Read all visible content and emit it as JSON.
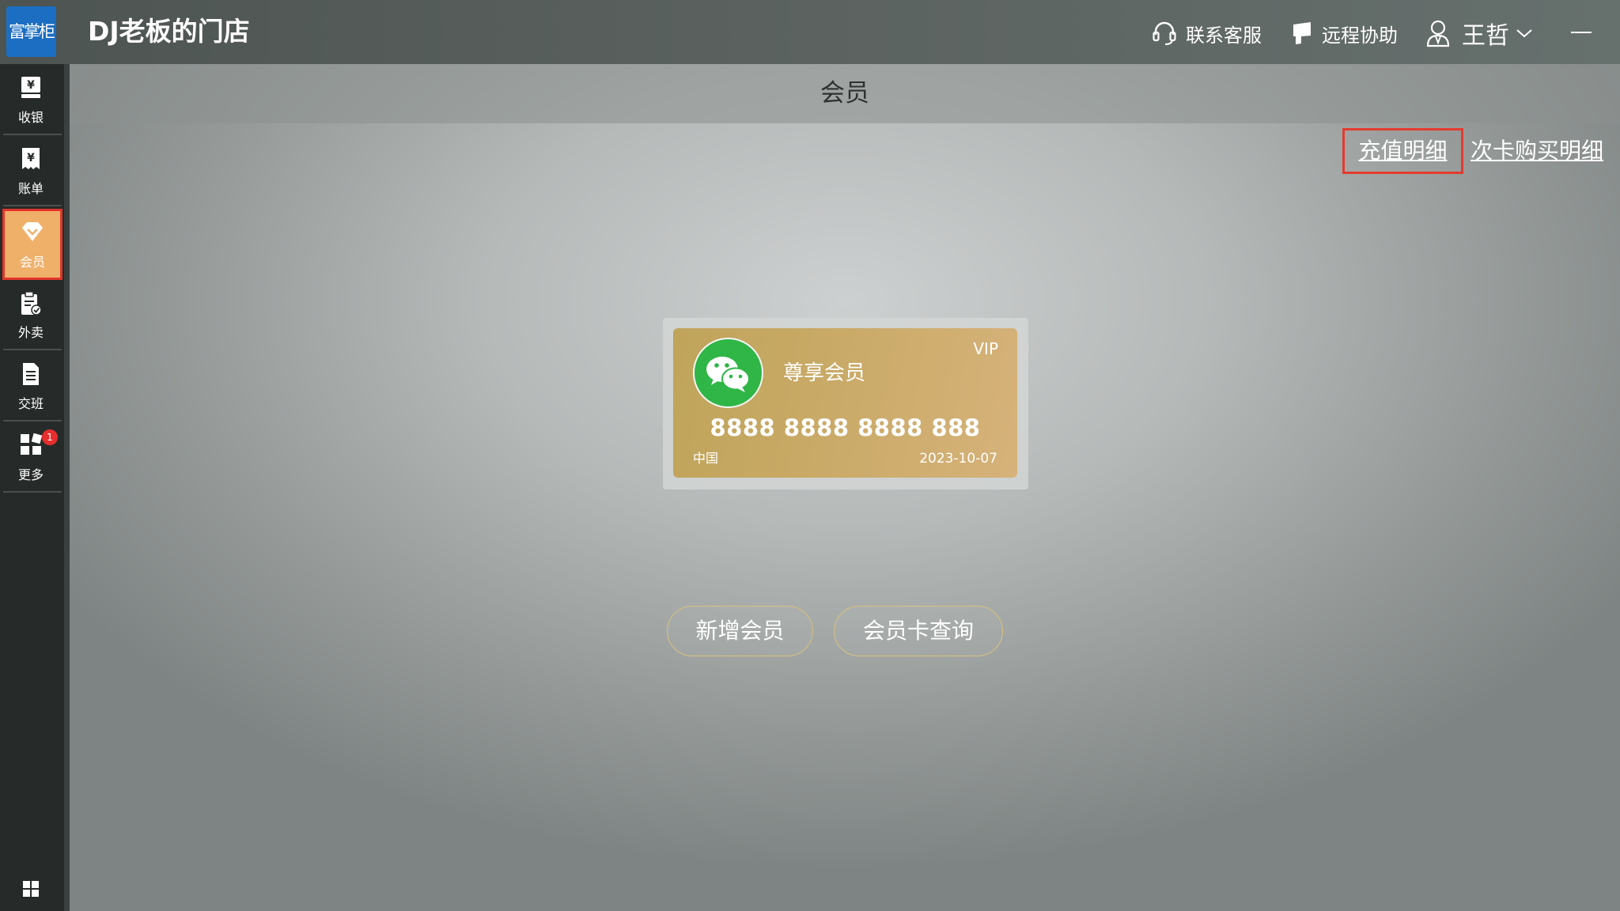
{
  "app": {
    "logo_text": "富掌柜",
    "store_title": "DJ老板的门店"
  },
  "header": {
    "support_label": "联系客服",
    "remote_label": "远程协助",
    "user_name": "王哲"
  },
  "sidebar": {
    "items": [
      {
        "label": "收银",
        "icon": "cashier-icon"
      },
      {
        "label": "账单",
        "icon": "bill-icon"
      },
      {
        "label": "会员",
        "icon": "member-diamond-icon",
        "active": true
      },
      {
        "label": "外卖",
        "icon": "takeout-clipboard-icon"
      },
      {
        "label": "交班",
        "icon": "shift-handover-icon"
      },
      {
        "label": "更多",
        "icon": "more-apps-icon",
        "badge": "1"
      }
    ]
  },
  "page": {
    "title": "会员",
    "links": {
      "recharge_detail": "充值明细",
      "count_card_detail": "次卡购买明细"
    }
  },
  "member_card": {
    "vip_label": "VIP",
    "card_name": "尊享会员",
    "card_number": "8888 8888 8888 888",
    "region": "中国",
    "date": "2023-10-07"
  },
  "actions": {
    "add_member": "新增会员",
    "query_card": "会员卡查询"
  },
  "colors": {
    "active_nav": "#efb06a",
    "highlight_border": "#e2352a",
    "logo_bg": "#1b6ec2",
    "wechat_green": "#2fb646",
    "card_gold": "#c9aa67"
  }
}
